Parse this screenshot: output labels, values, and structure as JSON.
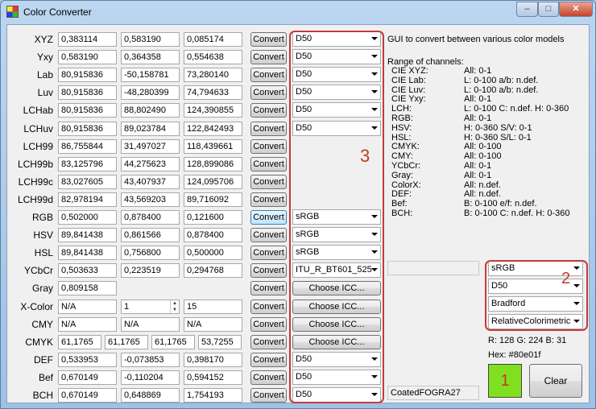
{
  "window": {
    "title": "Color Converter",
    "minimize": "–",
    "maximize": "□",
    "close": "✕"
  },
  "convert_label": "Convert",
  "choose_icc_label": "Choose ICC...",
  "rows": [
    {
      "label": "XYZ",
      "values": [
        "0,383114",
        "0,583190",
        "0,085174"
      ],
      "button": "Convert",
      "combo": "D50"
    },
    {
      "label": "Yxy",
      "values": [
        "0,583190",
        "0,364358",
        "0,554638"
      ],
      "button": "Convert",
      "combo": "D50"
    },
    {
      "label": "Lab",
      "values": [
        "80,915836",
        "-50,158781",
        "73,280140"
      ],
      "button": "Convert",
      "combo": "D50"
    },
    {
      "label": "Luv",
      "values": [
        "80,915836",
        "-48,280399",
        "74,794633"
      ],
      "button": "Convert",
      "combo": "D50"
    },
    {
      "label": "LCHab",
      "values": [
        "80,915836",
        "88,802490",
        "124,390855"
      ],
      "button": "Convert",
      "combo": "D50"
    },
    {
      "label": "LCHuv",
      "values": [
        "80,915836",
        "89,023784",
        "122,842493"
      ],
      "button": "Convert",
      "combo": "D50"
    },
    {
      "label": "LCH99",
      "values": [
        "86,755844",
        "31,497027",
        "118,439661"
      ],
      "button": "Convert"
    },
    {
      "label": "LCH99b",
      "values": [
        "83,125796",
        "44,275623",
        "128,899086"
      ],
      "button": "Convert"
    },
    {
      "label": "LCH99c",
      "values": [
        "83,027605",
        "43,407937",
        "124,095706"
      ],
      "button": "Convert"
    },
    {
      "label": "LCH99d",
      "values": [
        "82,978194",
        "43,569203",
        "89,716092"
      ],
      "button": "Convert"
    },
    {
      "label": "RGB",
      "values": [
        "0,502000",
        "0,878400",
        "0,121600"
      ],
      "button": "Convert",
      "combo": "sRGB",
      "hot": true
    },
    {
      "label": "HSV",
      "values": [
        "89,841438",
        "0,861566",
        "0,878400"
      ],
      "button": "Convert",
      "combo": "sRGB"
    },
    {
      "label": "HSL",
      "values": [
        "89,841438",
        "0,756800",
        "0,500000"
      ],
      "button": "Convert",
      "combo": "sRGB"
    },
    {
      "label": "YCbCr",
      "values": [
        "0,503633",
        "0,223519",
        "0,294768"
      ],
      "button": "Convert",
      "combo": "ITU_R_BT601_525"
    },
    {
      "label": "Gray",
      "values": [
        "0,809158"
      ],
      "button": "Convert",
      "icc": true
    },
    {
      "label": "X-Color",
      "values": [
        "N/A",
        "1",
        "15"
      ],
      "button": "Convert",
      "icc": true,
      "spinner": true
    },
    {
      "label": "CMY",
      "values": [
        "N/A",
        "N/A",
        "N/A"
      ],
      "button": "Convert",
      "icc": true
    },
    {
      "label": "CMYK",
      "values": [
        "61,1765",
        "61,1765",
        "61,1765",
        "53,7255"
      ],
      "button": "Convert",
      "icc": true
    },
    {
      "label": "DEF",
      "values": [
        "0,533953",
        "-0,073853",
        "0,398170"
      ],
      "button": "Convert",
      "combo": "D50"
    },
    {
      "label": "Bef",
      "values": [
        "0,670149",
        "-0,110204",
        "0,594152"
      ],
      "button": "Convert",
      "combo": "D50"
    },
    {
      "label": "BCH",
      "values": [
        "0,670149",
        "0,648869",
        "1,754193"
      ],
      "button": "Convert",
      "combo": "D50"
    }
  ],
  "info": {
    "intro": "GUI to convert between various color models",
    "range_title": "Range of channels:",
    "ranges": [
      {
        "name": "CIE XYZ:",
        "value": "All: 0-1"
      },
      {
        "name": "CIE Lab:",
        "value": "L: 0-100 a/b: n.def."
      },
      {
        "name": "CIE Luv:",
        "value": "L: 0-100 a/b: n.def."
      },
      {
        "name": "CIE Yxy:",
        "value": "All: 0-1"
      },
      {
        "name": "LCH:",
        "value": "L: 0-100 C: n.def. H: 0-360"
      },
      {
        "name": "RGB:",
        "value": "All: 0-1"
      },
      {
        "name": "HSV:",
        "value": "H: 0-360 S/V: 0-1"
      },
      {
        "name": "HSL:",
        "value": "H: 0-360 S/L: 0-1"
      },
      {
        "name": "CMYK:",
        "value": "All: 0-100"
      },
      {
        "name": "CMY:",
        "value": "All: 0-100"
      },
      {
        "name": "YCbCr:",
        "value": "All: 0-1"
      },
      {
        "name": "Gray:",
        "value": "All: 0-1"
      },
      {
        "name": "ColorX:",
        "value": "All: n.def."
      },
      {
        "name": "DEF:",
        "value": "All: n.def."
      },
      {
        "name": "Bef:",
        "value": "B: 0-100 e/f: n.def."
      },
      {
        "name": "BCH:",
        "value": "B: 0-100 C: n.def. H: 0-360"
      }
    ]
  },
  "icc_profile_text": "CoatedFOGRA27",
  "settings": {
    "rgb_space": "sRGB",
    "white_point": "D50",
    "adaptation": "Bradford",
    "intent": "RelativeColorimetric"
  },
  "annotations": {
    "one": "1",
    "two": "2",
    "three": "3"
  },
  "result": {
    "rgb": "R: 128 G: 224 B: 31",
    "hex": "Hex: #80e01f",
    "swatch_color": "#80e01f"
  },
  "clear_label": "Clear",
  "colors": {
    "annotation_red": "#c23b3b",
    "swatch": "#80e01f"
  }
}
